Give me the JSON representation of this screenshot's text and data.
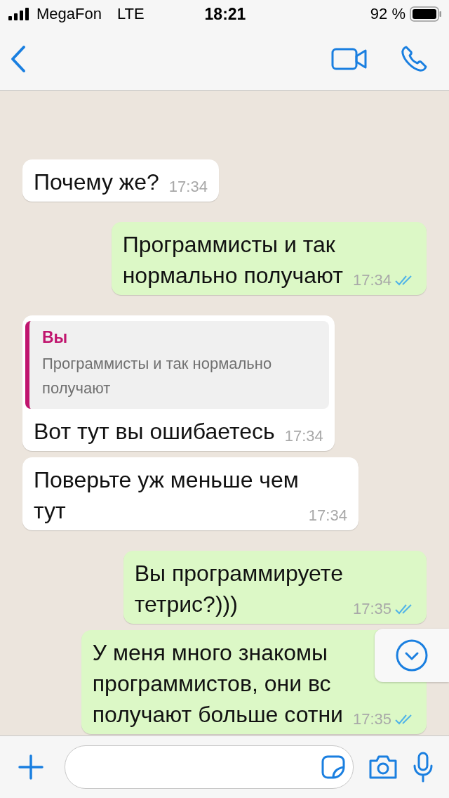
{
  "status_bar": {
    "carrier": "MegaFon",
    "network": "LTE",
    "time": "18:21",
    "battery": "92 %"
  },
  "messages": [
    {
      "outgoing": false,
      "text": "Почему же?",
      "time": "17:34"
    },
    {
      "outgoing": true,
      "text": "Программисты и так\nнормально получают",
      "time": "17:34",
      "read": true
    },
    {
      "outgoing": false,
      "quote": {
        "author": "Вы",
        "text": "Программисты и так нормально\nполучают"
      },
      "text": "Вот тут вы ошибаетесь",
      "time": "17:34"
    },
    {
      "outgoing": false,
      "text": "Поверьте уж меньше чем\nтут",
      "time": "17:34"
    },
    {
      "outgoing": true,
      "text": "Вы программируете\nтетрис?)))",
      "time": "17:35",
      "read": true
    },
    {
      "outgoing": true,
      "text": "У меня много знакомы\nпрограммистов, они вс\nполучают больше сотни",
      "time": "17:35",
      "read": true
    }
  ]
}
